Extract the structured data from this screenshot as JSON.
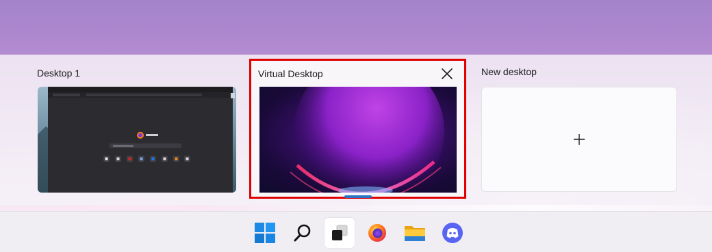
{
  "desktops": [
    {
      "label": "Desktop 1"
    },
    {
      "label": "Virtual Desktop",
      "selected": true
    },
    {
      "label": "New desktop"
    }
  ],
  "browser_preview": {
    "brand": "Firefox"
  },
  "taskbar": {
    "items": [
      "start-icon",
      "search-icon",
      "task-view-icon",
      "firefox-icon",
      "file-explorer-icon",
      "discord-icon"
    ]
  },
  "colors": {
    "selection_border": "#e00000",
    "active_indicator": "#2a73c5"
  }
}
